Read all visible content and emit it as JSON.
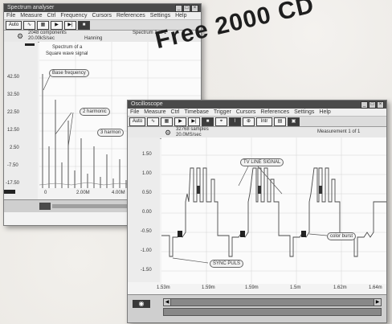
{
  "overlay_text": "Free 2000 CD",
  "spectrum": {
    "title": "Spectrum analyser",
    "menu": [
      "File",
      "Measure",
      "Ctrl",
      "Frequency",
      "Cursors",
      "References",
      "Settings",
      "Help"
    ],
    "toolbar": [
      "Auto"
    ],
    "info_line1": "2048 components",
    "info_line2": "20.00kS/sec",
    "info_window": "Hanning",
    "info_spectrum": "Spectrum 1 of 1",
    "plot_title_1": "Spectrum of a",
    "plot_title_2": "Square wave signal",
    "callouts": [
      "Base frequency",
      "2 harmonic",
      "3 harmon"
    ],
    "y_ticks": [
      "42.50",
      "32.50",
      "22.50",
      "12.50",
      "2.50",
      "-7.50",
      "-17.50"
    ],
    "x_ticks": [
      "0",
      "2.00M",
      "4.00M"
    ]
  },
  "scope": {
    "title": "Oscilloscope",
    "menu": [
      "File",
      "Measure",
      "Ctrl",
      "Timebase",
      "Trigger",
      "Cursors",
      "References",
      "Settings",
      "Help"
    ],
    "toolbar": [
      "Auto",
      "Intr"
    ],
    "info_line1": "32768 samples",
    "info_line2": "20.0MS/sec",
    "info_meas": "Measurement 1 of 1",
    "signal_label": "TV LINE SIGNAL",
    "sync_label": "SYNC PULS",
    "color_label": "color burst",
    "y_ticks": [
      "1.50",
      "1.00",
      "0.50",
      "0.00",
      "-0.50",
      "-1.00",
      "-1.50"
    ],
    "x_ticks": [
      "1.53m",
      "1.59m",
      "1.59m",
      "1.5m",
      "1.62m",
      "1.64m"
    ]
  }
}
